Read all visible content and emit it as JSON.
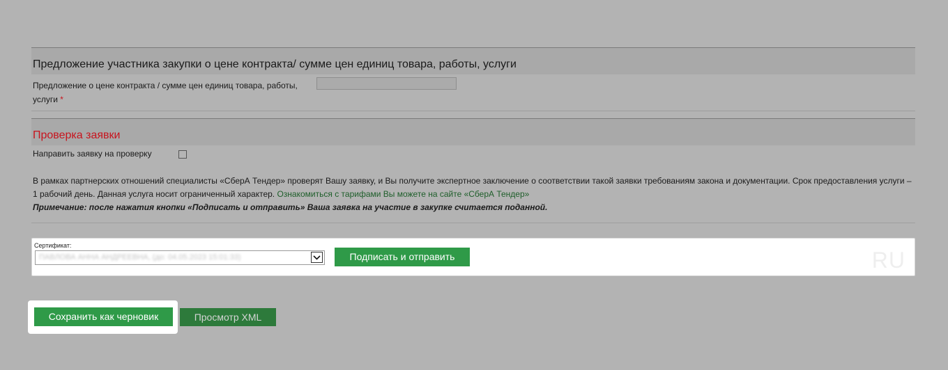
{
  "price_section": {
    "title": "Предложение участника закупки о цене контракта/ сумме цен единиц товара, работы, услуги",
    "field_label": "Предложение о цене контракта / сумме цен единиц товара, работы, услуги",
    "required_mark": "*",
    "field_value": ""
  },
  "check_section": {
    "title": "Проверка заявки",
    "checkbox_label": "Направить заявку на проверку",
    "checkbox_checked": false,
    "info_text": "В рамках партнерских отношений специалисты «СберА Тендер» проверят Вашу заявку, и Вы получите экспертное заключение о соответствии такой заявки требованиям закона и документации. Срок предоставления услуги – 1 рабочий день. Данная услуга носит ограниченный характер. ",
    "info_link": "Ознакомиться с тарифами Вы можете на сайте «СберА Тендер»",
    "note": "Примечание: после нажатия кнопки «Подписать и отправить» Ваша заявка на участие в закупке считается поданной."
  },
  "certificate": {
    "label": "Сертификат:",
    "selected_value": "ПАВЛОВА АННА АНДРЕЕВНА, (до: 04.05.2023 15:01:33)",
    "sign_button": "Подписать и отправить",
    "watermark": "RU"
  },
  "actions": {
    "save_draft": "Сохранить как черновик",
    "view_xml": "Просмотр XML"
  },
  "colors": {
    "background": "#b3b3b3",
    "button_green": "#2f9a48",
    "button_dark_green": "#2d7a3b",
    "required_red": "#c8141e",
    "link_green": "#1e5e2a"
  }
}
